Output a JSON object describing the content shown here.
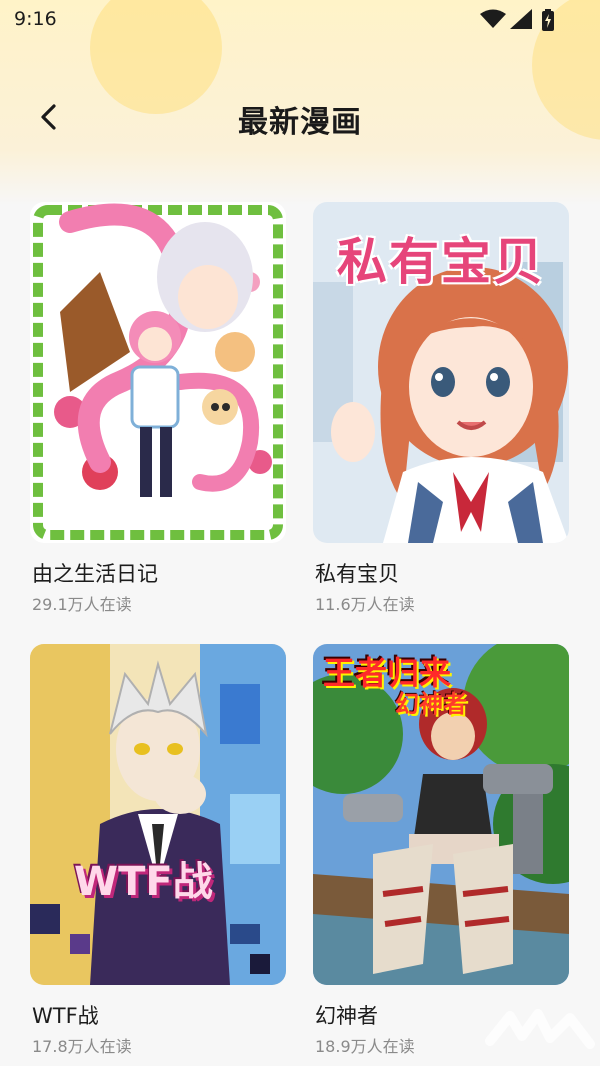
{
  "status_bar": {
    "time": "9:16",
    "icons": [
      "wifi-icon",
      "signal-icon",
      "battery-charging-icon"
    ]
  },
  "header": {
    "back_icon": "back-arrow-icon",
    "title": "最新漫画"
  },
  "colors": {
    "header_gradient_top": "#fff3c8",
    "background": "#f7f7f7",
    "title_text": "#1a1a1a",
    "subtext": "#8a8a8a"
  },
  "comics": [
    {
      "title": "由之生活日记",
      "readers": "29.1万人在读",
      "cover_text": ""
    },
    {
      "title": "私有宝贝",
      "readers": "11.6万人在读",
      "cover_text": "私有宝贝"
    },
    {
      "title": "WTF战",
      "readers": "17.8万人在读",
      "cover_text": "WTF战"
    },
    {
      "title": "幻神者",
      "readers": "18.9万人在读",
      "cover_text": "王者归来",
      "cover_subtext": "幻神者"
    }
  ]
}
